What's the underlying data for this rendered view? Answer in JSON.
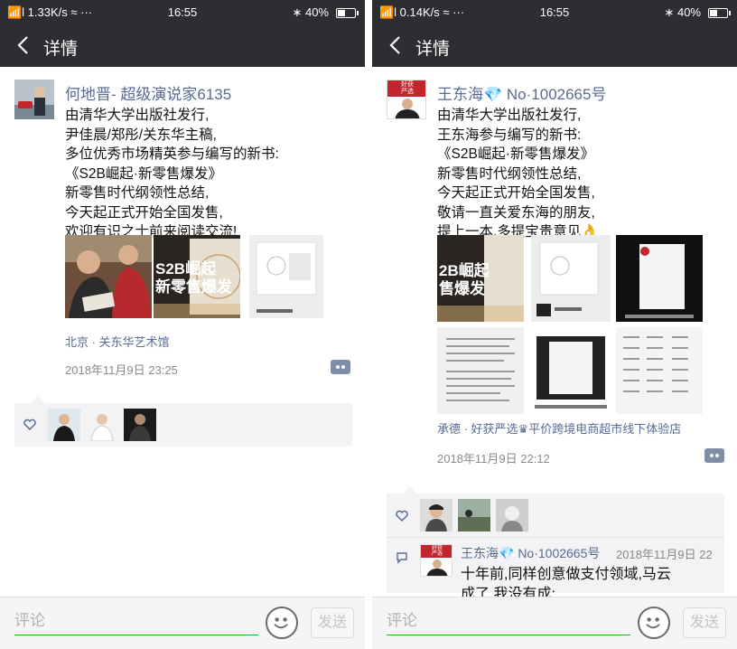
{
  "screens": [
    {
      "status": {
        "left": "📶l 1.33K/s ≈ ···",
        "time": "16:55",
        "right": "∗ 40%"
      },
      "nav": {
        "title": "详情"
      },
      "post": {
        "author": "何地晋- 超级演说家6135",
        "lines": [
          "由清华大学出版社发行,",
          "尹佳晨/郑彤/关东华主稿,",
          "多位优秀市场精英参与编写的新书:",
          "《S2B崛起·新零售爆发》",
          "新零售时代纲领性总结,",
          "今天起正式开始全国发售,",
          "欢迎有识之士前来阅读交流!"
        ],
        "cover_text": "S2B崛起\n新零售爆发",
        "location": "北京 · 关东华艺术馆",
        "time": "2018年11月9日 23:25"
      },
      "comment_box": {
        "placeholder": "评论",
        "send": "发送"
      }
    },
    {
      "status": {
        "left": "📶l 0.14K/s ≈ ···",
        "time": "16:55",
        "right": "∗ 40%"
      },
      "nav": {
        "title": "详情"
      },
      "post": {
        "author": "王东海💎 No·1002665号",
        "avatar_text": "好获\n严选",
        "lines": [
          "由清华大学出版社发行,",
          "王东海参与编写的新书:",
          "《S2B崛起·新零售爆发》",
          "新零售时代纲领性总结,",
          "今天起正式开始全国发售,",
          "敬请一直关爱东海的朋友,",
          "提上一本,多提宝贵意见👌"
        ],
        "cover_text": "2B崛起\n售爆发",
        "location": "承德 · 好获严选♛平价跨境电商超市线下体验店",
        "time": "2018年11月9日 22:12"
      },
      "comment": {
        "name": "王东海💎 No·1002665号",
        "time": "2018年11月9日 22",
        "text": "十年前,同样创意做支付领域,马云",
        "text2": "成了,我没有成;"
      },
      "comment_box": {
        "placeholder": "评论",
        "send": "发送"
      }
    }
  ],
  "colors": {
    "bar": "#2d2e32",
    "link": "#576b95",
    "accent_green": "#20b020",
    "panel": "#f3f3f5"
  },
  "icons": [
    "back-arrow-icon",
    "wifi-icon",
    "bluetooth-icon",
    "battery-icon",
    "heart-icon",
    "comment-icon",
    "emoji-icon",
    "more-icon"
  ]
}
